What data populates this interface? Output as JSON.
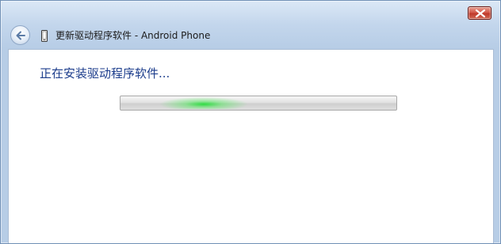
{
  "window": {
    "title": "更新驱动程序软件 - Android Phone"
  },
  "titlebar": {
    "close_icon": "close-icon",
    "back_icon": "back-arrow-icon",
    "device_icon": "phone-device-icon"
  },
  "main": {
    "status_text": "正在安装驱动程序软件...",
    "progress": {
      "style": "marquee",
      "glow_color": "#22d43a"
    }
  },
  "colors": {
    "status_text": "#1c3d8c",
    "close_button": "#c0392b"
  }
}
